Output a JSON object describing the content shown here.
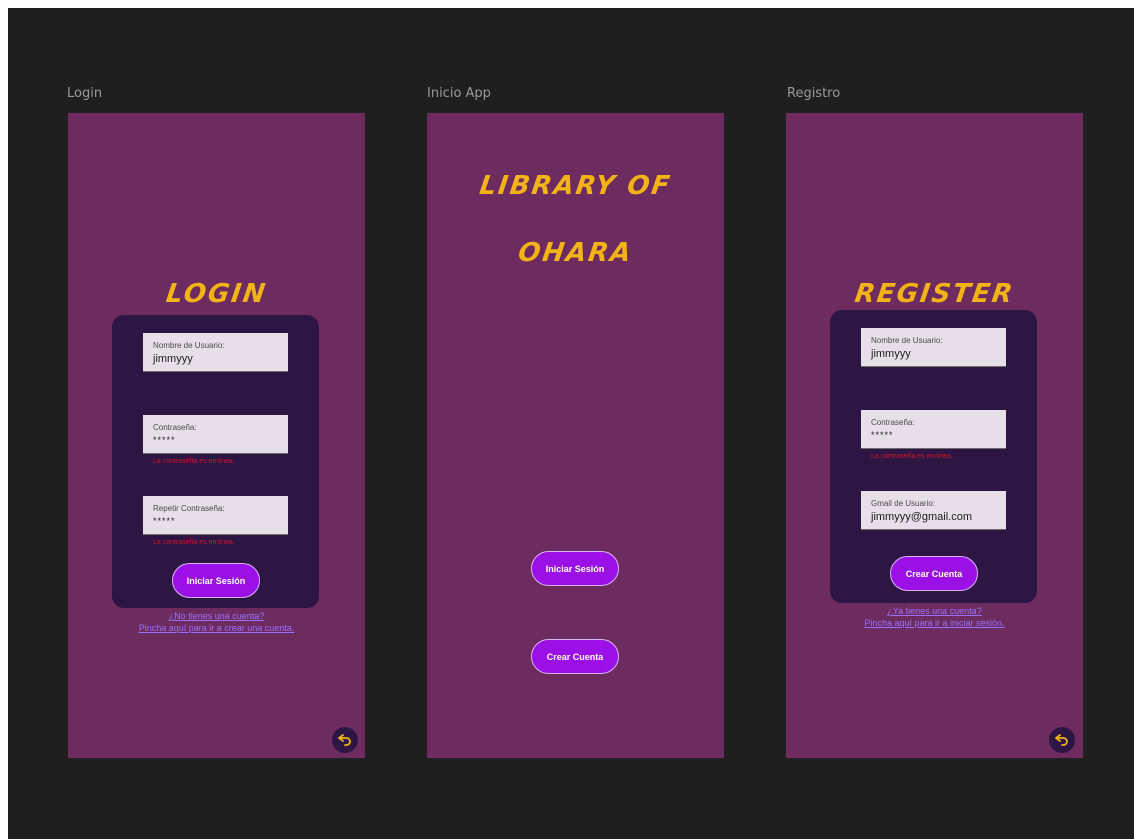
{
  "frames": {
    "login": {
      "label": "Login",
      "title": "LOGIN",
      "fields": [
        {
          "label": "Nombre de Usuario:",
          "value": "jimmyyy"
        },
        {
          "label": "Contraseña:",
          "value": "*****",
          "error": "La contraseña es errónea."
        },
        {
          "label": "Repetir Contraseña:",
          "value": "*****",
          "error": "La contraseña es errónea."
        }
      ],
      "button": "Iniciar Sesión",
      "link_line1": "¿No tienes una cuenta?",
      "link_line2": "Pincha aquí para ir a crear una cuenta."
    },
    "inicio": {
      "label": "Inicio App",
      "title_line1": "LIBRARY OF",
      "title_line2": "OHARA",
      "button_login": "Iniciar Sesión",
      "button_create": "Crear Cuenta"
    },
    "registro": {
      "label": "Registro",
      "title": "REGISTER",
      "fields": [
        {
          "label": "Nombre de Usuario:",
          "value": "jimmyyy"
        },
        {
          "label": "Contraseña:",
          "value": "*****",
          "error": "La contraseña es errónea."
        },
        {
          "label": "Gmail de Usuario:",
          "value": "jimmyyy@gmail.com"
        }
      ],
      "button": "Crear Cuenta",
      "link_line1": "¿Ya tienes una cuenta?",
      "link_line2": "Pincha aquí para ir a iniciar sesión."
    }
  },
  "colors": {
    "canvas": "#1f1f1f",
    "phone": "#6e2b5f",
    "panel": "#2d1544",
    "title": "#f2b316",
    "button": "#9a10e6",
    "error": "#d4162b",
    "link": "#9a72ff"
  },
  "icons": {
    "back": "undo-arrow-icon"
  }
}
